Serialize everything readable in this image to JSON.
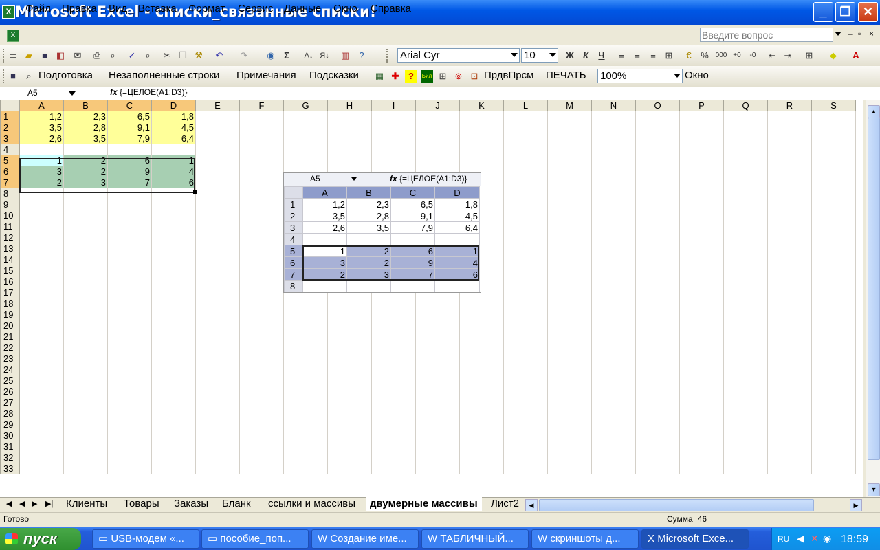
{
  "window": {
    "title": "Microsoft Excel - списки_связанные списки!",
    "minimize": "_",
    "maximize": "❐",
    "close": "✕"
  },
  "menu": {
    "items": [
      "Файл",
      "Правка",
      "Вид",
      "Вставка",
      "Формат",
      "Сервис",
      "Данные",
      "Окно",
      "Справка"
    ],
    "ask_placeholder": "Введите вопрос"
  },
  "toolbar1": {
    "font": "Arial Cyr",
    "size": "10",
    "bold": "Ж",
    "italic": "К",
    "underline": "Ч",
    "percent": "%",
    "thousands": "000"
  },
  "toolbar2": {
    "items": [
      "Подготовка",
      "Незаполненные строки",
      "Примечания",
      "Подсказки"
    ],
    "prdvprsm": "ПрдвПрсм",
    "print": "ПЕЧАТЬ",
    "zoom": "100%",
    "window": "Окно"
  },
  "formula_bar": {
    "name_box": "A5",
    "fx": "fx",
    "formula": "{=ЦЕЛОЕ(A1:D3)}"
  },
  "columns": [
    "A",
    "B",
    "C",
    "D",
    "E",
    "F",
    "G",
    "H",
    "I",
    "J",
    "K",
    "L",
    "M",
    "N",
    "O",
    "P",
    "Q",
    "R",
    "S"
  ],
  "cells": {
    "r1": [
      "1,2",
      "2,3",
      "6,5",
      "1,8"
    ],
    "r2": [
      "3,5",
      "2,8",
      "9,1",
      "4,5"
    ],
    "r3": [
      "2,6",
      "3,5",
      "7,9",
      "6,4"
    ],
    "r5": [
      "1",
      "2",
      "6",
      "1"
    ],
    "r6": [
      "3",
      "2",
      "9",
      "4"
    ],
    "r7": [
      "2",
      "3",
      "7",
      "6"
    ]
  },
  "embedded": {
    "name_box": "A5",
    "formula": "{=ЦЕЛОЕ(A1:D3)}",
    "columns": [
      "A",
      "B",
      "C",
      "D"
    ]
  },
  "sheet_tabs": [
    "Клиенты",
    "Товары",
    "Заказы",
    "Бланк",
    "ссылки и массивы",
    "двумерные массивы",
    "Лист2"
  ],
  "active_tab": "двумерные массивы",
  "status": {
    "ready": "Готово",
    "sum": "Сумма=46"
  },
  "taskbar": {
    "start": "пуск",
    "tasks": [
      "USB-модем «...",
      "пособие_поп...",
      "Создание име...",
      "ТАБЛИЧНЫЙ...",
      "скриншоты д...",
      "Microsoft Exce..."
    ],
    "lang": "RU",
    "clock": "18:59"
  }
}
